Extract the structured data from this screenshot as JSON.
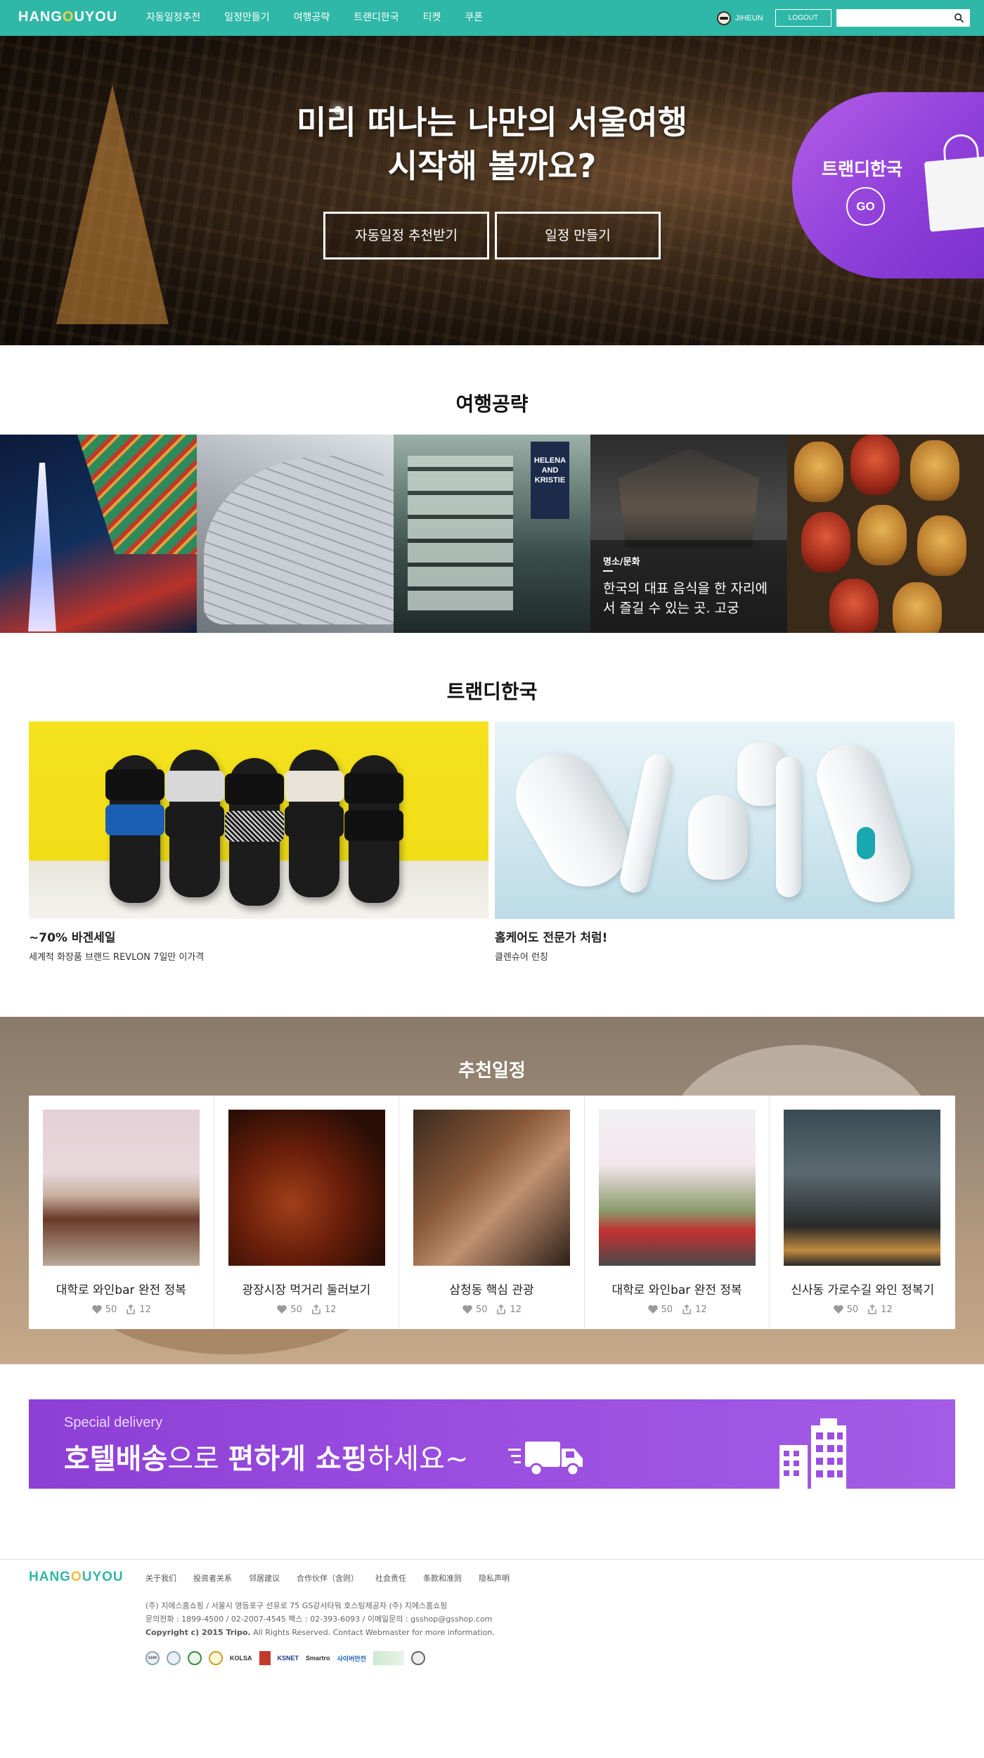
{
  "header": {
    "logo": {
      "pre": "HANG",
      "o": "O",
      "post": "UYOU"
    },
    "nav": [
      "자동일정추천",
      "일정만들기",
      "여행공략",
      "트랜디한국",
      "티켓",
      "쿠폰"
    ],
    "username": "JIHEUN",
    "logout_label": "LOGOUT",
    "search_placeholder": "",
    "search_icon": "search-icon"
  },
  "hero": {
    "title_line1": "미리 떠나는 나만의 서울여행",
    "title_line2": "시작해 볼까요?",
    "button1": "자동일정 추천받기",
    "button2": "일정 만들기",
    "promo_title": "트랜디한국",
    "promo_go": "GO"
  },
  "guide": {
    "title": "여행공략",
    "featured": {
      "category": "명소/문화",
      "desc": "한국의 대표 음식을 한 자리에서 즐길 수 있는 곳. 고궁"
    },
    "sign_text": "HELENA AND KRISTIE"
  },
  "trendy": {
    "title": "트랜디한국",
    "items": [
      {
        "title": "~70% 바겐세일",
        "subtitle": "세계적 화장품 브랜드 REVLON 7일만 이가격"
      },
      {
        "title": "홈케어도 전문가 처럼!",
        "subtitle": "클렌슈어 런칭"
      }
    ]
  },
  "recommended": {
    "title": "추천일정",
    "cards": [
      {
        "title": "대학로 와인bar 완전 정복",
        "likes": "50",
        "shares": "12"
      },
      {
        "title": "광장시장 먹거리 둘러보기",
        "likes": "50",
        "shares": "12"
      },
      {
        "title": "삼청동 핵심 관광",
        "likes": "50",
        "shares": "12"
      },
      {
        "title": "대학로 와인bar 완전 정복",
        "likes": "50",
        "shares": "12"
      },
      {
        "title": "신사동 가로수길 와인 정복기",
        "likes": "50",
        "shares": "12"
      }
    ]
  },
  "banner": {
    "subtitle": "Special delivery",
    "part1": "호텔배송",
    "part2": "으로 ",
    "part3": "편하게 쇼핑",
    "part4": "하세요~"
  },
  "footer": {
    "logo": {
      "pre": "HANG",
      "o": "O",
      "post": "UYOU"
    },
    "links": [
      "关于我们",
      "投资者关系",
      "邻居建议",
      "合作伙伴（含则）",
      "社会责任",
      "条款和准则",
      "隐私声明"
    ],
    "info1": "(주) 지에스홈쇼핑  / 서울시 영등포구 선유로 75 GS강서타워 호스팅제공자 (주) 지에스홈쇼핑",
    "info2": "문의전화 : 1899-4500 / 02-2007-4545 팩스 : 02-393-6093 / 이메일문의 : gsshop@gsshop.com",
    "copyright": "Copyright c) 2015 Tripo.",
    "copyright_rest": " All Rights Reserved. Contact Webmaster for more information.",
    "badges": [
      "ccm",
      "KOLSA",
      "KSNET",
      "Smartro",
      "사이버안전"
    ]
  },
  "colors": {
    "header_bg": "#2fb7a8",
    "promo_purple": "#8f3fd9",
    "banner_purple": "#9b4ee0",
    "logo_o": "#f6d13a"
  }
}
